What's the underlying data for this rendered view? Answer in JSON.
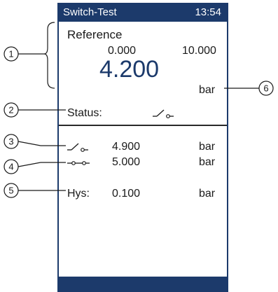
{
  "titlebar": {
    "title": "Switch-Test",
    "time": "13:54"
  },
  "reference": {
    "label": "Reference",
    "min": "0.000",
    "max": "10.000",
    "value": "4.200",
    "unit": "bar"
  },
  "status": {
    "label": "Status:",
    "icon": "switch-open-icon"
  },
  "switch_points": [
    {
      "icon": "switch-open-icon",
      "value": "4.900",
      "unit": "bar"
    },
    {
      "icon": "switch-closed-icon",
      "value": "5.000",
      "unit": "bar"
    }
  ],
  "hysteresis": {
    "label": "Hys:",
    "value": "0.100",
    "unit": "bar"
  },
  "callouts": [
    "1",
    "2",
    "3",
    "4",
    "5",
    "6"
  ],
  "colors": {
    "brand": "#1c3a6b",
    "text": "#1a1a1a"
  }
}
